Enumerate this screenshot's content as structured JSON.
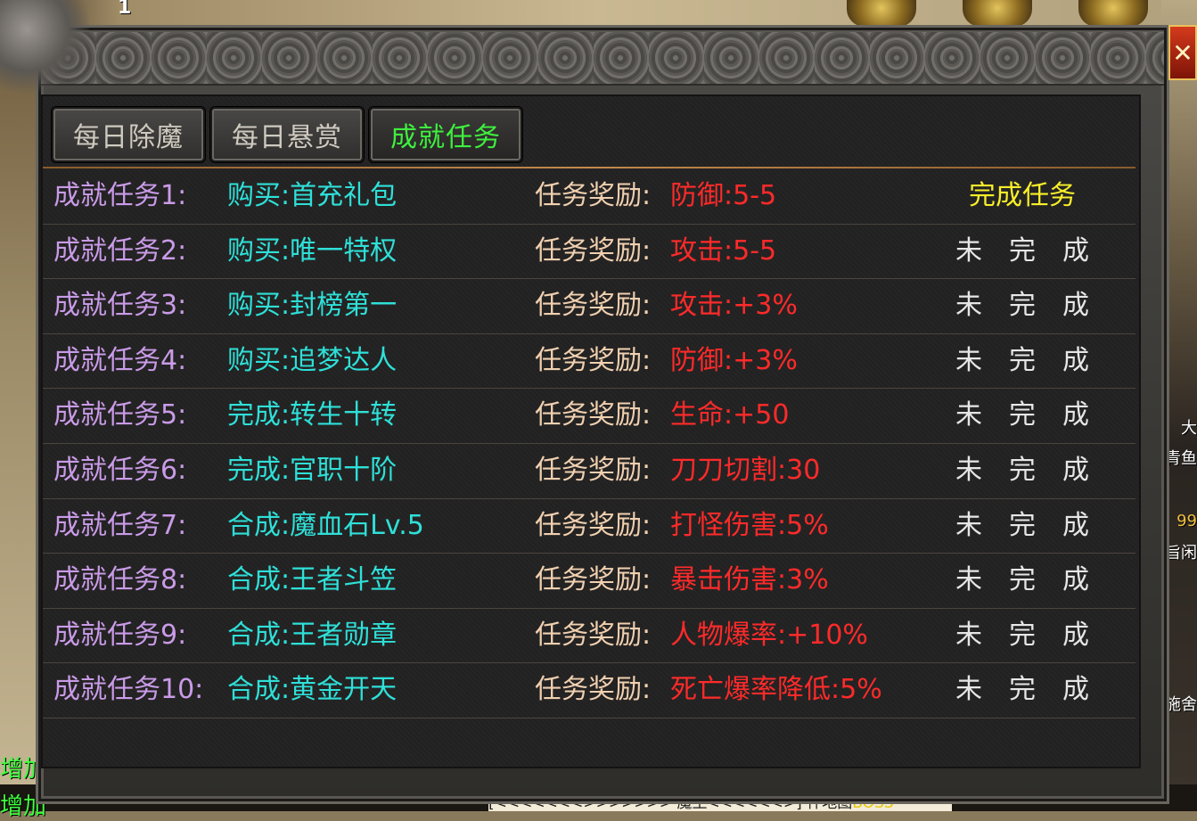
{
  "hud": {
    "level": "1",
    "left_messages": [
      "增加.",
      "增加"
    ],
    "chat_text": "[<<<<<<<>>>>>>> 魔王<<<<<<>] 件地图",
    "chat_boss": "BOSS",
    "right_fragments": [
      "大",
      "青鱼",
      "99",
      "旨闲",
      "施舍"
    ]
  },
  "window": {
    "close_label": "✕"
  },
  "tabs": [
    {
      "label": "每日除魔",
      "active": false
    },
    {
      "label": "每日悬赏",
      "active": false
    },
    {
      "label": "成就任务",
      "active": true
    }
  ],
  "reward_label": "任务奖励:",
  "status_undone": [
    "未",
    "完",
    "成"
  ],
  "tasks": [
    {
      "name": "成就任务1:",
      "req": "购买:首充礼包",
      "reward": "防御:5-5",
      "status": "完成任务",
      "done": true
    },
    {
      "name": "成就任务2:",
      "req": "购买:唯一特权",
      "reward": "攻击:5-5",
      "status": "未 完 成",
      "done": false
    },
    {
      "name": "成就任务3:",
      "req": "购买:封榜第一",
      "reward": "攻击:+3%",
      "status": "未 完 成",
      "done": false
    },
    {
      "name": "成就任务4:",
      "req": "购买:追梦达人",
      "reward": "防御:+3%",
      "status": "未 完 成",
      "done": false
    },
    {
      "name": "成就任务5:",
      "req": "完成:转生十转",
      "reward": "生命:+50",
      "status": "未 完 成",
      "done": false
    },
    {
      "name": "成就任务6:",
      "req": "完成:官职十阶",
      "reward": "刀刀切割:30",
      "status": "未 完 成",
      "done": false
    },
    {
      "name": "成就任务7:",
      "req": "合成:魔血石Lv.5",
      "reward": "打怪伤害:5%",
      "status": "未 完 成",
      "done": false
    },
    {
      "name": "成就任务8:",
      "req": "合成:王者斗笠",
      "reward": "暴击伤害:3%",
      "status": "未 完 成",
      "done": false
    },
    {
      "name": "成就任务9:",
      "req": "合成:王者勋章",
      "reward": "人物爆率:+10%",
      "status": "未 完 成",
      "done": false
    },
    {
      "name": "成就任务10:",
      "req": "合成:黄金开天",
      "reward": "死亡爆率降低:5%",
      "status": "未 完 成",
      "done": false
    }
  ],
  "colors": {
    "task_name": "#c99be8",
    "requirement": "#2ee0d8",
    "reward_label": "#f0d0b0",
    "reward_value": "#ff2a2a",
    "status_done": "#f7ef2a",
    "status_undone": "#e6e6e6",
    "tab_active": "#3ef03e"
  }
}
